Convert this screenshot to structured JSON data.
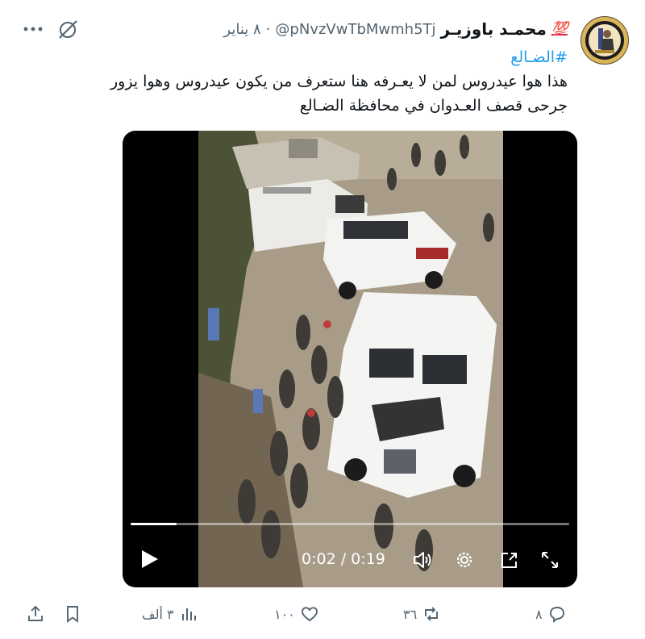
{
  "tweet": {
    "display_name": "محمـد باوزيـر",
    "name_emoji": "💯",
    "handle": "@pNvzVwTbMwmh5Tj",
    "separator": "·",
    "date": "٨ يناير",
    "hashtag": "#الضـالع",
    "text_line1": "هذا هوا عيدروس لمن لا يعـرفه هنا ستعرف من يكون عيدروس وهوا يزور",
    "text_line2": "جرحى قصف العـدوان في محافظة الضـالع"
  },
  "video": {
    "current_time": "0:02",
    "separator": "/",
    "duration": "0:19",
    "progress_fraction": 0.105
  },
  "actions": {
    "replies": "٨",
    "reposts": "٣٦",
    "likes": "١٠٠",
    "views": "٣ ألف"
  },
  "colors": {
    "accent": "#1d9bf0",
    "muted": "#536471",
    "text": "#0f1419"
  },
  "icons": {
    "more": "more-dots-icon",
    "grok": "grok-slash-circle-icon",
    "play": "play-icon",
    "volume": "volume-icon",
    "settings": "gear-icon",
    "pip": "picture-in-picture-icon",
    "fullscreen": "expand-icon",
    "reply": "reply-bubble-icon",
    "repost": "repost-icon",
    "like": "heart-icon",
    "views": "views-bars-icon",
    "bookmark": "bookmark-icon",
    "share": "share-upload-icon"
  }
}
